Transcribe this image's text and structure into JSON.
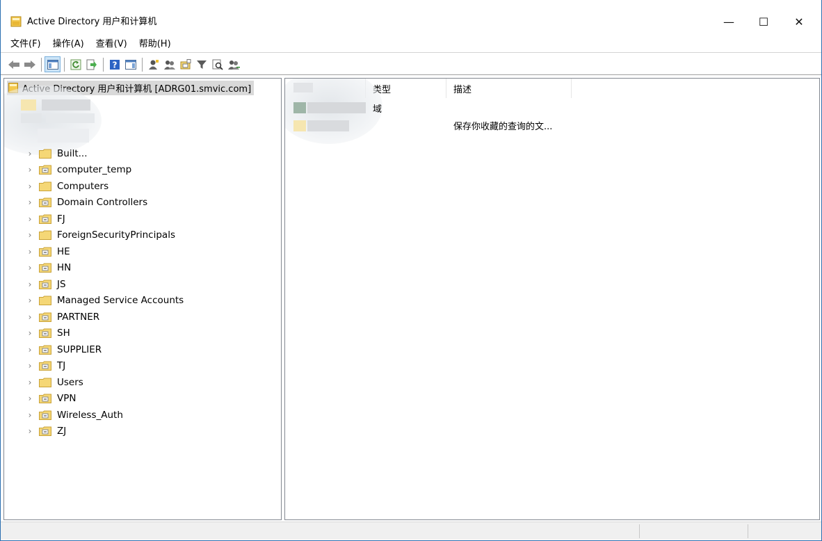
{
  "window": {
    "title": "Active Directory 用户和计算机",
    "minimize_glyph": "—",
    "maximize_glyph": "☐",
    "close_glyph": "✕"
  },
  "menu": [
    "文件(F)",
    "操作(A)",
    "查看(V)",
    "帮助(H)"
  ],
  "toolbar": {
    "icons": [
      "back-arrow-icon",
      "forward-arrow-icon",
      "show-hide-console-tree-icon",
      "refresh-icon",
      "export-list-icon",
      "help-icon",
      "show-action-pane-icon",
      "create-user-icon",
      "create-group-icon",
      "create-ou-icon",
      "filter-icon",
      "find-icon",
      "add-to-group-icon"
    ]
  },
  "tree": {
    "root_label": "Active Directory 用户和计算机 [ADRG01.smvic.com]",
    "items": [
      {
        "label": "Built...",
        "type": "container"
      },
      {
        "label": "computer_temp",
        "type": "ou"
      },
      {
        "label": "Computers",
        "type": "container"
      },
      {
        "label": "Domain Controllers",
        "type": "ou"
      },
      {
        "label": "FJ",
        "type": "ou"
      },
      {
        "label": "ForeignSecurityPrincipals",
        "type": "container"
      },
      {
        "label": "HE",
        "type": "ou"
      },
      {
        "label": "HN",
        "type": "ou"
      },
      {
        "label": "JS",
        "type": "ou"
      },
      {
        "label": "Managed Service Accounts",
        "type": "container"
      },
      {
        "label": "PARTNER",
        "type": "ou"
      },
      {
        "label": "SH",
        "type": "ou"
      },
      {
        "label": "SUPPLIER",
        "type": "ou"
      },
      {
        "label": "TJ",
        "type": "ou"
      },
      {
        "label": "Users",
        "type": "container"
      },
      {
        "label": "VPN",
        "type": "ou"
      },
      {
        "label": "Wireless_Auth",
        "type": "ou"
      },
      {
        "label": "ZJ",
        "type": "ou"
      }
    ]
  },
  "list": {
    "columns": [
      "",
      "类型",
      "描述"
    ],
    "rows": [
      {
        "type": "域",
        "description": ""
      },
      {
        "type": "",
        "description": "保存你收藏的查询的文..."
      }
    ]
  },
  "colors": {
    "accent_border": "#2b6fb0",
    "folder_yellow": "#f5d776",
    "selection_gray": "#d9d9d9"
  }
}
